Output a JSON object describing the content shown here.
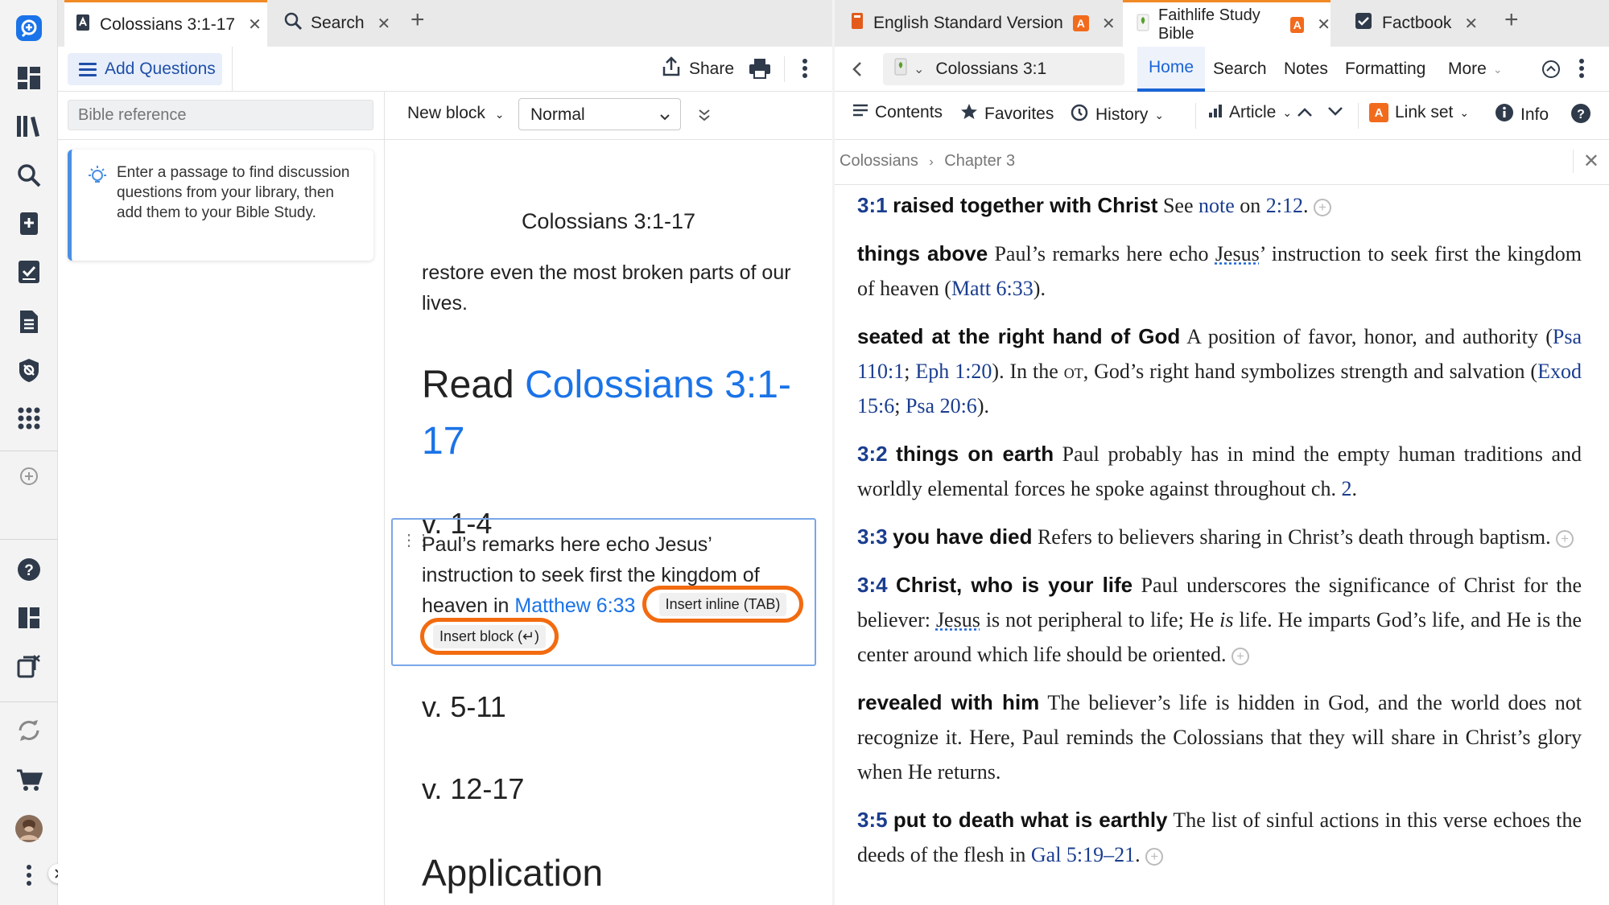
{
  "left_tabs": [
    {
      "label": "Colossians 3:1-17",
      "icon": "study-icon"
    },
    {
      "label": "Search",
      "icon": "search-icon"
    }
  ],
  "right_tabs": [
    {
      "label": "English Standard Version",
      "icon": "bible-book-icon",
      "badge": "A"
    },
    {
      "label": "Faithlife Study Bible",
      "icon": "study-bible-icon",
      "badge": "A"
    },
    {
      "label": "Factbook",
      "icon": "factbook-icon"
    }
  ],
  "left_toolbar": {
    "add_questions": "Add Questions",
    "share": "Share"
  },
  "left_toolbar2": {
    "reference_placeholder": "Bible reference",
    "new_block": "New block",
    "style": "Normal"
  },
  "hint": {
    "text": "Enter a passage to find discussion questions from your library, then add them to your Bible Study."
  },
  "doc": {
    "title": "Colossians 3:1-17",
    "intro": "restore even the most broken parts of our lives.",
    "read_prefix": "Read ",
    "read_link": "Colossians 3:1-17",
    "sections": [
      "v. 1-4",
      "v. 5-11",
      "v. 12-17",
      "Application"
    ],
    "block_text": "Paul’s remarks here echo Jesus’ instruction to seek first the kingdom of heaven in ",
    "block_link": "Matthew 6:33",
    "insert_inline": "Insert inline (TAB)",
    "insert_block": "Insert block (↵)"
  },
  "right_toolbar": {
    "reference": "Colossians 3:1",
    "nav": [
      "Home",
      "Search",
      "Notes",
      "Formatting",
      "More"
    ],
    "tools": {
      "contents": "Contents",
      "favorites": "Favorites",
      "history": "History",
      "article": "Article",
      "link_set": "Link set",
      "link_set_badge": "A",
      "info": "Info"
    }
  },
  "breadcrumb": {
    "book": "Colossians",
    "chapter": "Chapter 3"
  },
  "notes": {
    "n1": {
      "num": "3:1",
      "head": "raised together with Christ",
      "t1": " See ",
      "l1": "note",
      "t2": " on ",
      "l2": "2:12",
      "t3": "."
    },
    "n2": {
      "head": "things above",
      "t1": " Paul’s remarks here echo ",
      "l1": "Jesus",
      "t2": "’ instruction to seek first the kingdom of heaven (",
      "l2": "Matt 6:33",
      "t3": ")."
    },
    "n3": {
      "head": "seated at the right hand of God",
      "t1": " A position of favor, honor, and authority (",
      "l1": "Psa 110:1",
      "t2": "; ",
      "l2": "Eph 1:20",
      "t3": "). In the ",
      "sc": "ot",
      "t4": ", God’s right hand symbolizes strength and salvation (",
      "l3": "Exod 15:6",
      "t5": "; ",
      "l4": "Psa 20:6",
      "t6": ")."
    },
    "n4": {
      "num": "3:2",
      "head": "things on earth",
      "t1": " Paul probably has in mind the empty human traditions and worldly elemental forces he spoke against throughout ch. ",
      "l1": "2",
      "t2": "."
    },
    "n5": {
      "num": "3:3",
      "head": "you have died",
      "t1": " Refers to believers sharing in Christ’s death through baptism."
    },
    "n6": {
      "num": "3:4",
      "head": "Christ, who is your life",
      "t1": " Paul underscores the significance of Christ for the believer: ",
      "l1": "Jesus",
      "t2": " is not peripheral to life; He ",
      "em": "is",
      "t3": " life. He imparts God’s life, and He is the center around which life should be oriented."
    },
    "n7": {
      "head": "revealed with him",
      "t1": " The believer’s life is hidden in God, and the world does not recognize it. Here, Paul reminds the Colossians that they will share in Christ’s glory when He returns."
    },
    "n8": {
      "num": "3:5",
      "head": "put to death what is earthly",
      "t1": " The list of sinful actions in this verse echoes the deeds of the flesh in ",
      "l1": "Gal 5:19–21",
      "t2": "."
    }
  },
  "colors": {
    "accent_orange": "#f26b10",
    "link_blue": "#1a73e8",
    "note_blue": "#1a3d8f",
    "home_blue": "#1a63d6"
  }
}
